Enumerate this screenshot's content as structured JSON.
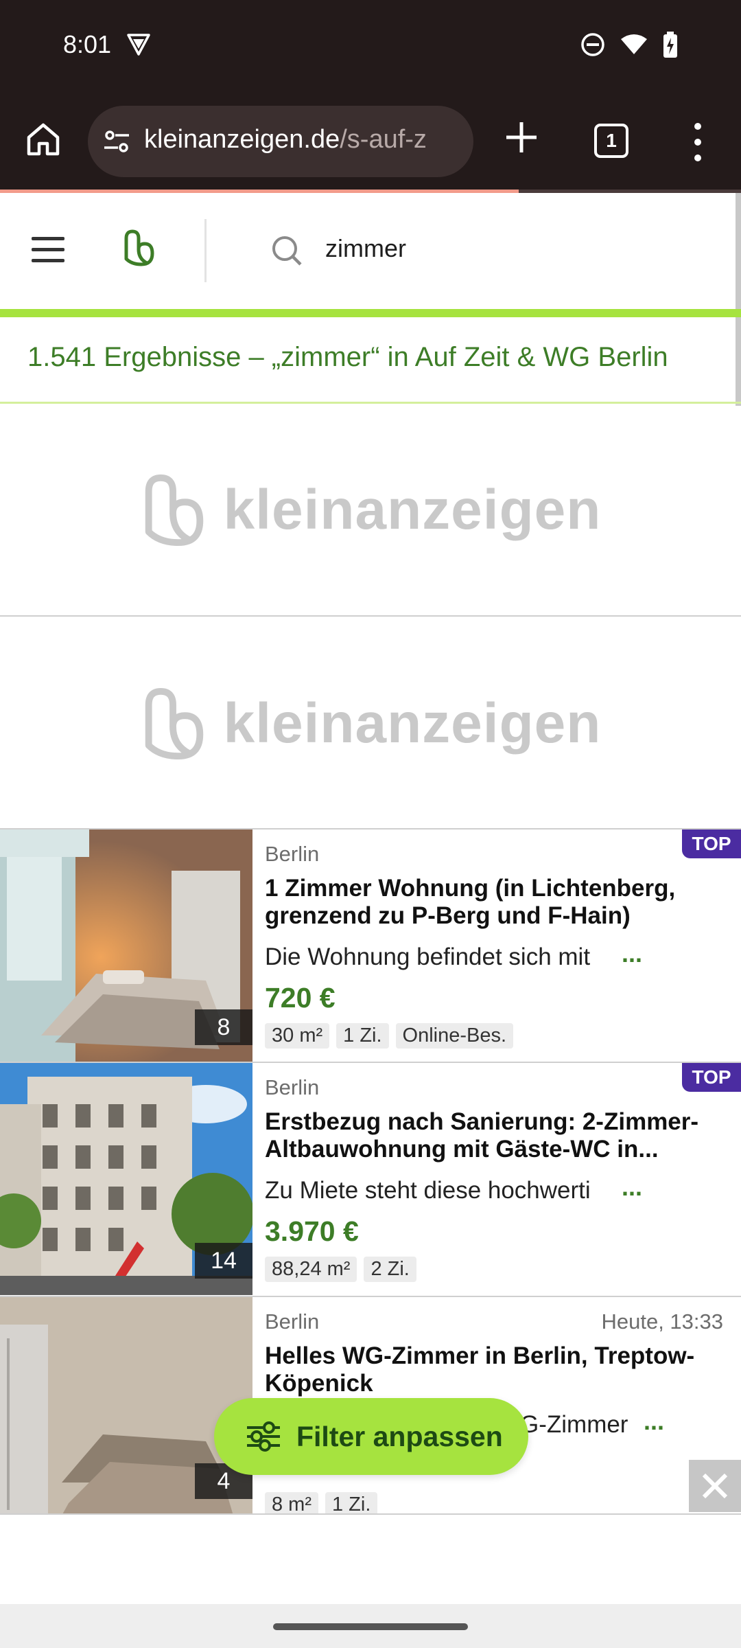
{
  "status_bar": {
    "time": "8:01"
  },
  "browser": {
    "url_main": "kleinanzeigen.de",
    "url_rest": "/s-auf-z",
    "tab_count": "1"
  },
  "search": {
    "query": "zimmer"
  },
  "results": {
    "summary": "1.541 Ergebnisse – „zimmer“ in Auf Zeit & WG Berlin"
  },
  "ads": {
    "logo_text": "kleinanzeigen"
  },
  "listings": [
    {
      "location": "Berlin",
      "badge": "TOP",
      "date": "",
      "title": "1 Zimmer Wohnung (in Lichtenberg, grenzend zu P-Berg und F-Hain)",
      "description": "Die Wohnung befindet sich mit",
      "more": "...",
      "price": "720 €",
      "tags": [
        "30 m²",
        "1 Zi.",
        "Online-Bes."
      ],
      "image_count": "8"
    },
    {
      "location": "Berlin",
      "badge": "TOP",
      "date": "",
      "title": "Erstbezug nach Sanierung: 2-Zimmer-Altbauwohnung mit Gäste-WC in...",
      "description": "Zu Miete steht diese hochwerti",
      "more": "...",
      "price": "3.970 €",
      "tags": [
        "88,24 m²",
        "2 Zi."
      ],
      "image_count": "14"
    },
    {
      "location": "Berlin",
      "badge": "",
      "date": "Heute, 13:33",
      "title": "Helles WG-Zimmer in Berlin, Treptow-Köpenick",
      "description": "G-Zimmer",
      "more": "...",
      "price": "",
      "tags": [
        "8 m²",
        "1 Zi."
      ],
      "image_count": "4"
    }
  ],
  "filter_button": {
    "label": "Filter anpassen"
  },
  "colors": {
    "brand_green": "#a6e33f",
    "text_green": "#3d7d27",
    "top_badge": "#4b2ca1",
    "browser_bg": "#231a1a"
  }
}
